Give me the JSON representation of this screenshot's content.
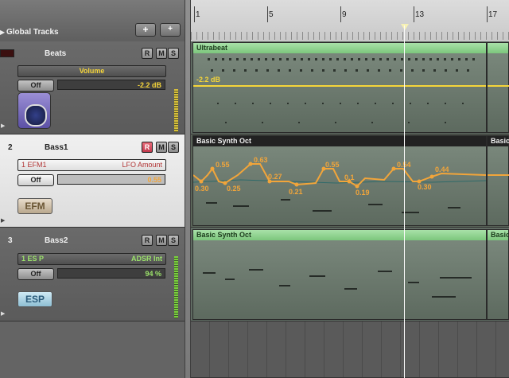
{
  "global_tracks": {
    "label": "Global Tracks",
    "add_label": "+",
    "add_folder_label": "+"
  },
  "ruler": {
    "bars": [
      "1",
      "5",
      "9",
      "13",
      "17"
    ]
  },
  "tracks": [
    {
      "number": "",
      "name": "Beats",
      "record": "R",
      "mute": "M",
      "solo": "S",
      "parameter": "Volume",
      "off_label": "Off",
      "value": "-2.2 dB",
      "plugin_icon": "drum-machine-icon",
      "region": {
        "name": "Ultrabeat",
        "automation_label": "-2.2 dB"
      },
      "region2_name": ""
    },
    {
      "number": "2",
      "name": "Bass1",
      "record": "R",
      "mute": "M",
      "solo": "S",
      "plugin_slot": "1 EFM1",
      "parameter": "LFO Amount",
      "off_label": "Off",
      "value": "0.55",
      "plugin_label": "EFM",
      "region": {
        "name": "Basic Synth Oct",
        "points": [
          "0.30",
          "0.55",
          "0.25",
          "0.63",
          "0.27",
          "0.21",
          "0.55",
          "0.1",
          "0.19",
          "0.54",
          "0.30",
          "0.44"
        ]
      },
      "region2_name": "Basic"
    },
    {
      "number": "3",
      "name": "Bass2",
      "record": "R",
      "mute": "M",
      "solo": "S",
      "plugin_slot": "1 ES P",
      "parameter": "ADSR Int",
      "off_label": "Off",
      "value": "94 %",
      "plugin_label": "ESP",
      "region": {
        "name": "Basic Synth Oct"
      },
      "region2_name": "Basic"
    }
  ],
  "colors": {
    "region_green": "#7cc67c",
    "automation_orange": "#f2a53a",
    "automation_yellow": "#f5d53a"
  }
}
